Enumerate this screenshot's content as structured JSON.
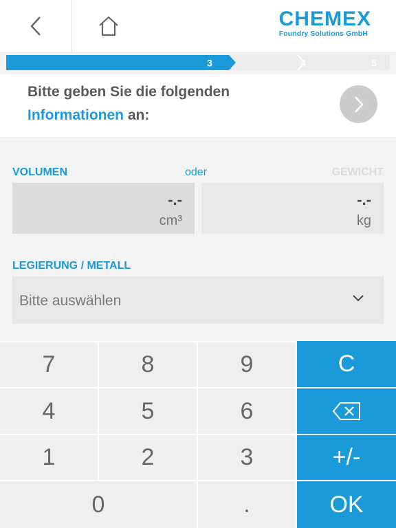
{
  "brand": {
    "name": "CHEMEX",
    "subtitle": "Foundry Solutions GmbH",
    "color": "#1a9ad9"
  },
  "header": {
    "back_icon": "chevron-left-icon",
    "home_icon": "home-icon"
  },
  "progress": {
    "steps": [
      "3",
      "4",
      "5"
    ],
    "current": "3"
  },
  "question": {
    "line1": "Bitte geben Sie die folgenden",
    "highlight": "Informationen",
    "line2_rest": " an:"
  },
  "volume": {
    "label": "VOLUMEN",
    "value": "-.-",
    "unit": "cm³"
  },
  "separator": "oder",
  "weight": {
    "label": "GEWICHT",
    "value": "-.-",
    "unit": "kg"
  },
  "alloy": {
    "label": "LEGIERUNG / METALL",
    "placeholder": "Bitte auswählen"
  },
  "keypad": {
    "k7": "7",
    "k8": "8",
    "k9": "9",
    "clear": "C",
    "k4": "4",
    "k5": "5",
    "k6": "6",
    "backspace_icon": "backspace-icon",
    "k1": "1",
    "k2": "2",
    "k3": "3",
    "sign": "+/-",
    "k0": "0",
    "dot": ".",
    "ok": "OK"
  }
}
